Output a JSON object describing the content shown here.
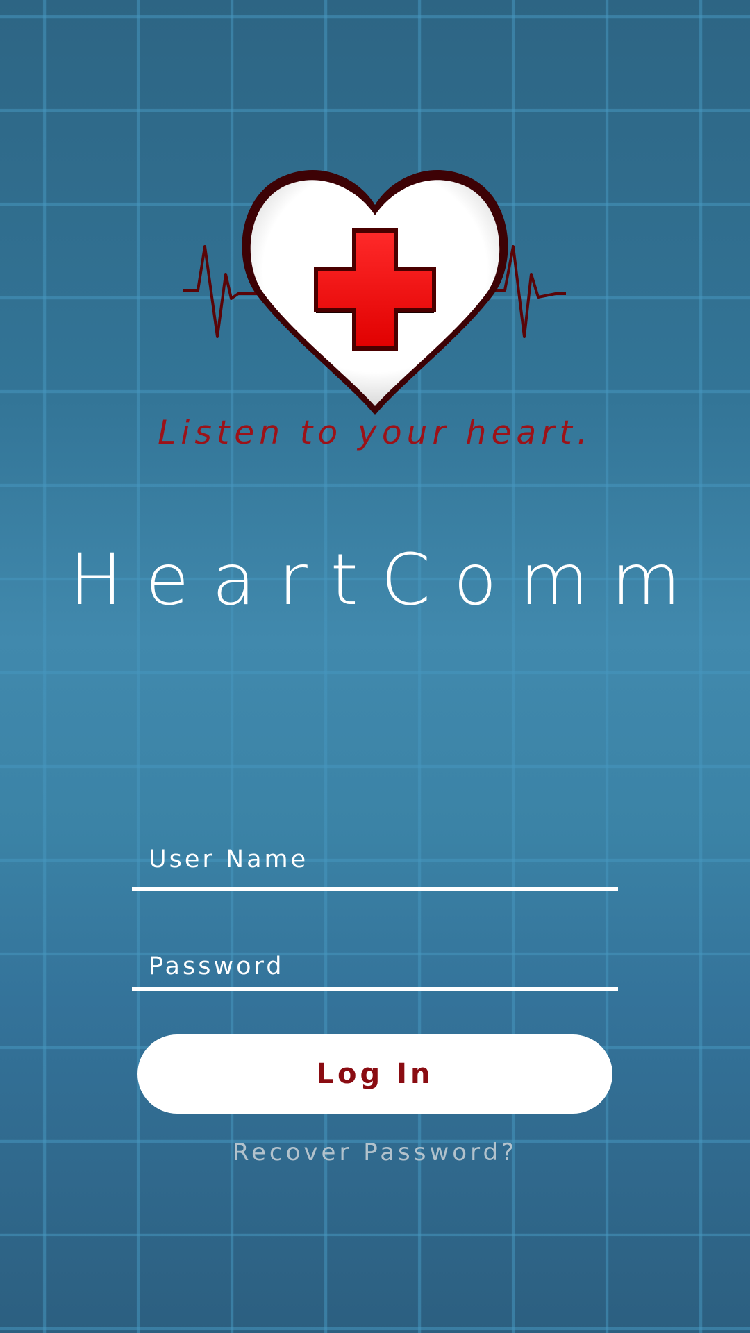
{
  "app": {
    "title": "HeartComm",
    "tagline": "Listen to your heart."
  },
  "login_form": {
    "username_placeholder": "User Name",
    "password_placeholder": "Password",
    "login_label": "Log In",
    "recover_label": "Recover Password?"
  },
  "colors": {
    "background": "#3b83a6",
    "brand_red": "#9c1218",
    "cross_red": "#ff1414",
    "text_white": "#ffffff",
    "link_gray": "#b2c2cc"
  },
  "icons": {
    "logo": "heart-cross-ekg-icon"
  }
}
